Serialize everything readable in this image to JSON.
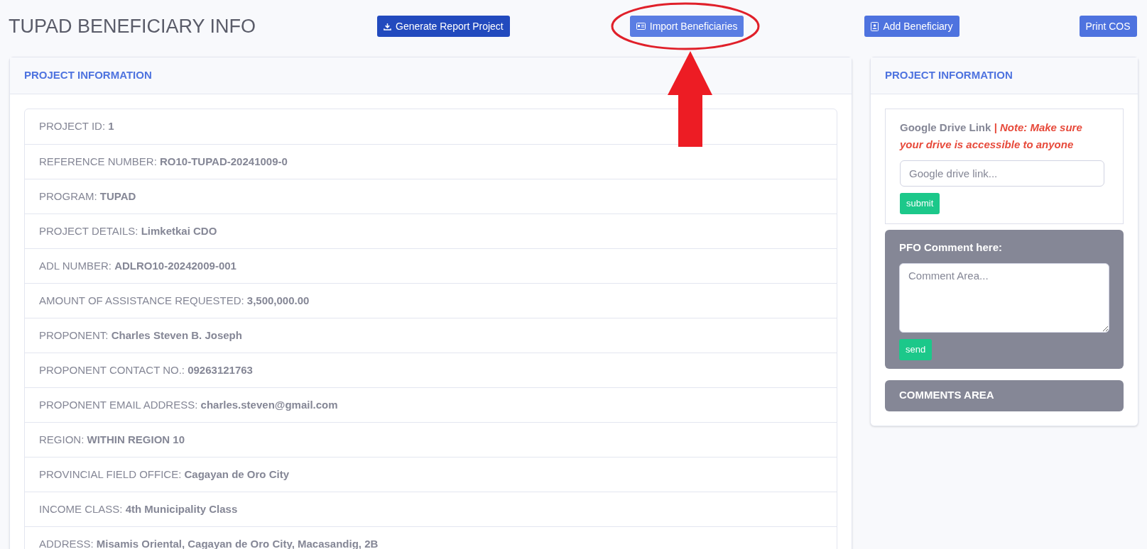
{
  "page_title": "TUPAD BENEFICIARY INFO",
  "header_buttons": [
    {
      "label": "Generate Report Project",
      "kind": "report"
    },
    {
      "label": "Import Beneficiaries",
      "kind": "import"
    },
    {
      "label": "Add Beneficiary",
      "kind": "add"
    },
    {
      "label": "Print COS",
      "kind": "print"
    }
  ],
  "project_card": {
    "title": "PROJECT INFORMATION",
    "rows": [
      "PROJECT ID: **1**",
      "REFERENCE NUMBER: **RO10-TUPAD-20241009-0**",
      "PROGRAM: **TUPAD**",
      "PROJECT DETAILS: **Limketkai CDO**",
      "ADL NUMBER: **ADLRO10-20242009-001**",
      "AMOUNT OF ASSISTANCE REQUESTED: **3,500,000.00**",
      "PROPONENT: **Charles Steven B. Joseph**",
      "PROPONENT CONTACT NO.: **09263121763**",
      "PROPONENT EMAIL ADDRESS: **charles.steven@gmail.com**",
      "REGION: **WITHIN REGION 10**",
      "PROVINCIAL FIELD OFFICE: **Cagayan de Oro City**",
      "INCOME CLASS: **4th Municipality Class**",
      "ADDRESS: **Misamis Oriental, Cagayan de Oro City, Macasandig, 2B**"
    ]
  },
  "side_card": {
    "title": "PROJECT INFORMATION",
    "drive_link": {
      "label": "Google Drive Link",
      "note": "| Note: Make sure your drive is accessible to anyone",
      "placeholder": "Google drive link...",
      "button": "submit"
    },
    "pfo_comment": {
      "label": "PFO Comment here:",
      "placeholder": "Comment Area...",
      "button": "send"
    },
    "comments_area": {
      "title": "COMMENTS AREA"
    }
  }
}
